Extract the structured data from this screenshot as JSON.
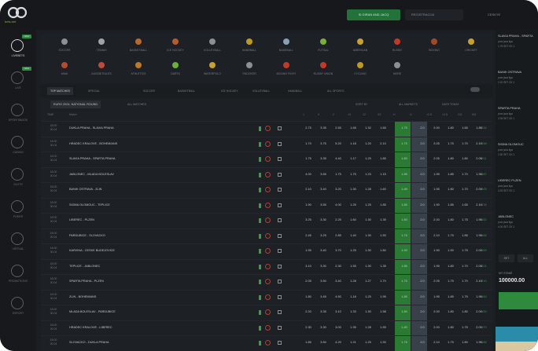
{
  "app": {
    "logo_text": "bets.bet",
    "login_label": "SI GIRAN AND JACQ",
    "register_label": "REGISTRACIJA",
    "language_label": "CESKYE"
  },
  "sidebar": {
    "items": [
      {
        "label": "LIVEBETS",
        "badge": "NEW",
        "icon": "live-icon",
        "active": true
      },
      {
        "label": "LIVE",
        "badge": "NEW",
        "icon": "broadcast-icon"
      },
      {
        "label": "SPORTSBOOK",
        "icon": "diamond-icon"
      },
      {
        "label": "CASINO",
        "icon": "chip-icon"
      },
      {
        "label": "SLOTS",
        "icon": "slot-icon"
      },
      {
        "label": "POKER",
        "icon": "spade-icon"
      },
      {
        "label": "VIRTUAL",
        "icon": "virtual-icon"
      },
      {
        "label": "PROMOTIONS",
        "icon": "gift-icon"
      },
      {
        "label": "ESPORT",
        "icon": "controller-icon"
      }
    ]
  },
  "sports": [
    {
      "label": "SOCCER",
      "color": "#8a9096"
    },
    {
      "label": "TENNIS",
      "color": "#a0a4a8"
    },
    {
      "label": "BASKETBALL",
      "color": "#b86a2a"
    },
    {
      "label": "ICE HOCKEY",
      "color": "#b85a2a"
    },
    {
      "label": "VOLLEYBALL",
      "color": "#8a9096"
    },
    {
      "label": "HANDBALL",
      "color": "#c09a20"
    },
    {
      "label": "BASEBALL",
      "color": "#8aa0b8"
    },
    {
      "label": "FUTSAL",
      "color": "#7ab03a"
    },
    {
      "label": "AMERICAN",
      "color": "#c8a030"
    },
    {
      "label": "RUGBY",
      "color": "#c0392b"
    },
    {
      "label": "BOXING",
      "color": "#a04a2a"
    },
    {
      "label": "CRICKET",
      "color": "#c8a030"
    },
    {
      "label": "MMA",
      "color": "#b84a2a"
    },
    {
      "label": "AUSSIE RULES",
      "color": "#c04a3a"
    },
    {
      "label": "ATHLETICS",
      "color": "#b87a2a"
    },
    {
      "label": "DARTS",
      "color": "#6ab03a"
    },
    {
      "label": "WATERPOLO",
      "color": "#c8a030"
    },
    {
      "label": "SNOOKER",
      "color": "#8a9096"
    },
    {
      "label": "BOXING FIGHT",
      "color": "#c0392b"
    },
    {
      "label": "RUGBY UNION",
      "color": "#c0392b"
    },
    {
      "label": "CYCLING",
      "color": "#c09a20"
    },
    {
      "label": "MORE",
      "color": "#8a9096"
    }
  ],
  "tabs": {
    "items": [
      "TOP MATCHES",
      "SPECIAL",
      "SOCCER",
      "BASKETBALL",
      "ICE HOCKEY",
      "VOLLEYBALL",
      "HANDBALL",
      "ALL SPORTS"
    ]
  },
  "league": {
    "name": "EURO 2024, NATIONAL ROUND",
    "secondary": "ALL MATCHES",
    "right1": "SORT BY",
    "right2": "ALL MARKETS",
    "right3": "DATE TODAY"
  },
  "table_head": {
    "time": "TIME",
    "match": "Match",
    "cols": [
      "1",
      "X",
      "2",
      "1X",
      "12",
      "X2",
      "H",
      "U",
      "<2.5",
      ">2.5",
      "GG",
      "NG",
      "1+",
      "MORE"
    ]
  },
  "rows": [
    {
      "time": [
        "18:00",
        "30.04"
      ],
      "match": "DUKLA PRAHA - SLAVIA PRAHA",
      "odds": [
        "2.75",
        "3.35",
        "2.55",
        "1.65",
        "1.32",
        "1.65",
        "1.75",
        "2.0",
        "2.00",
        "1.80",
        "1.65",
        "1.85"
      ],
      "more": "+234"
    },
    {
      "time": [
        "18:00",
        "30.04"
      ],
      "match": "HRADEC KRALOVE - BOHEMIANS",
      "odds": [
        "1.70",
        "3.75",
        "5.20",
        "1.18",
        "1.20",
        "2.10",
        "1.75",
        "2.0",
        "2.05",
        "1.75",
        "1.70",
        "2.10"
      ],
      "more": "+198"
    },
    {
      "time": [
        "18:00",
        "30.04"
      ],
      "match": "SLAVIA PRAHA - SPARTA PRAHA",
      "odds": [
        "1.75",
        "3.35",
        "4.40",
        "1.17",
        "1.25",
        "1.85",
        "1.80",
        "2.0",
        "2.05",
        "1.80",
        "1.80",
        "2.05"
      ],
      "more": "+211"
    },
    {
      "time": [
        "18:00",
        "30.04"
      ],
      "match": "JABLONEC - MLADA BOLESLAV",
      "odds": [
        "4.00",
        "3.65",
        "1.75",
        "1.75",
        "1.23",
        "1.15",
        "1.85",
        "2.0",
        "1.95",
        "1.85",
        "1.70",
        "1.95"
      ],
      "more": "+187"
    },
    {
      "time": [
        "18:00",
        "30.04"
      ],
      "match": "BANIK OSTRAVA - ZLIN",
      "odds": [
        "2.10",
        "3.40",
        "3.20",
        "1.30",
        "1.28",
        "1.60",
        "1.85",
        "2.0",
        "1.95",
        "1.80",
        "1.70",
        "2.00"
      ],
      "more": "+205"
    },
    {
      "time": [
        "18:00",
        "30.04"
      ],
      "match": "SIGMA OLOMOUC - TEPLICE",
      "odds": [
        "1.90",
        "3.55",
        "4.00",
        "1.25",
        "1.25",
        "1.85",
        "1.85",
        "2.0",
        "1.90",
        "1.85",
        "1.65",
        "2.10"
      ],
      "more": "+176"
    },
    {
      "time": [
        "18:00",
        "30.04"
      ],
      "match": "LIBEREC - PLZEN",
      "odds": [
        "3.25",
        "3.30",
        "2.25",
        "1.60",
        "1.30",
        "1.35",
        "1.80",
        "2.0",
        "2.00",
        "1.80",
        "1.75",
        "1.95"
      ],
      "more": "+192"
    },
    {
      "time": [
        "18:00",
        "30.04"
      ],
      "match": "PARDUBICE - SLOVACKO",
      "odds": [
        "2.45",
        "3.25",
        "2.85",
        "1.40",
        "1.30",
        "1.50",
        "1.75",
        "2.0",
        "2.10",
        "1.75",
        "1.85",
        "1.95"
      ],
      "more": "+168"
    },
    {
      "time": [
        "18:00",
        "30.04"
      ],
      "match": "KARVINA - CESKE BUDEJOVICE",
      "odds": [
        "1.95",
        "3.40",
        "3.70",
        "1.25",
        "1.30",
        "1.80",
        "1.90",
        "2.0",
        "1.90",
        "1.90",
        "1.75",
        "2.00"
      ],
      "more": "+199"
    },
    {
      "time": [
        "18:00",
        "30.04"
      ],
      "match": "TEPLICE - JABLONEC",
      "odds": [
        "3.10",
        "3.30",
        "2.30",
        "1.55",
        "1.30",
        "1.35",
        "1.85",
        "2.0",
        "1.95",
        "1.80",
        "1.70",
        "2.05"
      ],
      "more": "+201"
    },
    {
      "time": [
        "18:00",
        "30.04"
      ],
      "match": "SPARTA PRAHA - PLZEN",
      "odds": [
        "2.05",
        "3.50",
        "3.40",
        "1.28",
        "1.27",
        "1.70",
        "1.75",
        "2.0",
        "2.05",
        "1.75",
        "1.70",
        "2.10"
      ],
      "more": "+215"
    },
    {
      "time": [
        "18:00",
        "30.04"
      ],
      "match": "ZLIN - BOHEMIANS",
      "odds": [
        "1.80",
        "3.45",
        "4.50",
        "1.18",
        "1.25",
        "1.95",
        "1.85",
        "2.0",
        "1.95",
        "1.85",
        "1.75",
        "1.95"
      ],
      "more": "+183"
    },
    {
      "time": [
        "18:00",
        "30.04"
      ],
      "match": "MLADA BOLESLAV - PARDUBICE",
      "odds": [
        "2.20",
        "3.35",
        "3.10",
        "1.33",
        "1.30",
        "1.58",
        "1.80",
        "2.0",
        "2.00",
        "1.80",
        "1.80",
        "2.00"
      ],
      "more": "+190"
    },
    {
      "time": [
        "18:00",
        "30.04"
      ],
      "match": "HRADEC KRALOVE - LIBEREC",
      "odds": [
        "2.30",
        "3.30",
        "3.00",
        "1.35",
        "1.28",
        "1.55",
        "1.80",
        "2.0",
        "2.00",
        "1.80",
        "1.75",
        "2.00"
      ],
      "more": "+179"
    },
    {
      "time": [
        "18:00",
        "30.04"
      ],
      "match": "SLOVACKO - DUKLA PRAHA",
      "odds": [
        "1.85",
        "3.50",
        "4.20",
        "1.21",
        "1.25",
        "1.90",
        "1.75",
        "2.0",
        "2.10",
        "1.75",
        "1.80",
        "1.95"
      ],
      "more": "+188"
    }
  ],
  "betslip": {
    "entries": [
      {
        "title": "SLAVIA PRAHA - SPARTA",
        "sub": "prva jaca liga",
        "odds": "1.75 SET CK 1"
      },
      {
        "title": "BANIK OSTRAVA",
        "sub": "prva jaca liga",
        "odds": "2.10 SET CK 1"
      },
      {
        "title": "SPARTA PRAHA",
        "sub": "prva jaca liga",
        "odds": "2.05 SET CK 1"
      },
      {
        "title": "SIGMA OLOMOUC",
        "sub": "prva jaca liga",
        "odds": "1.90 SET CK 1"
      },
      {
        "title": "LIBEREC PLZEN",
        "sub": "prva jaca liga",
        "odds": "3.25 SET CK 1"
      },
      {
        "title": "JABLONEC",
        "sub": "prva jaca liga",
        "odds": "4.00 SET CK 1"
      }
    ],
    "btn1": "SET",
    "btn2": "ALL",
    "stake_label": "MY STAKE",
    "stake_value": "100000.00"
  }
}
